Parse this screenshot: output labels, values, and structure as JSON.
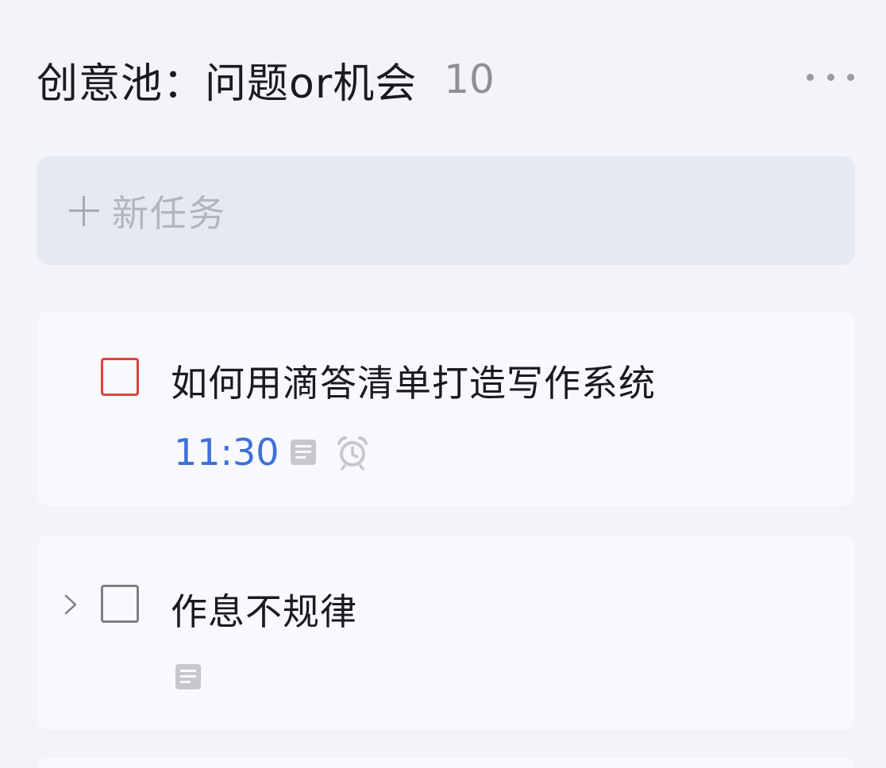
{
  "list": {
    "title": "创意池：问题or机会",
    "count": "10"
  },
  "add_task": {
    "placeholder": "新任务"
  },
  "tasks": [
    {
      "title": "如何用滴答清单打造写作系统",
      "time": "11:30",
      "priority_color": "#e0413a",
      "icons": [
        "note-icon",
        "alarm-icon"
      ]
    },
    {
      "title": "作息不规律",
      "time": "",
      "priority_color": "#7d7f85",
      "icons": [
        "expand-icon",
        "note-icon"
      ]
    }
  ],
  "colors": {
    "accent": "#3f70d8",
    "priority_high": "#e0413a"
  }
}
